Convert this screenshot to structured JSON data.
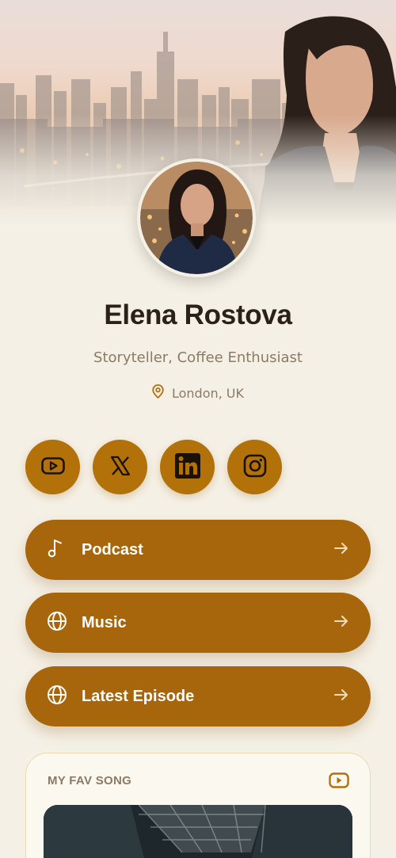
{
  "profile": {
    "name": "Elena Rostova",
    "bio": "Storyteller, Coffee Enthusiast",
    "location": "London, UK"
  },
  "social": [
    {
      "network": "YouTube",
      "icon": "youtube-icon"
    },
    {
      "network": "X",
      "icon": "x-icon"
    },
    {
      "network": "LinkedIn",
      "icon": "linkedin-icon"
    },
    {
      "network": "Instagram",
      "icon": "instagram-icon"
    }
  ],
  "links": [
    {
      "label": "Podcast",
      "icon": "music-note-icon"
    },
    {
      "label": "Music",
      "icon": "globe-icon"
    },
    {
      "label": "Latest Episode",
      "icon": "globe-icon"
    }
  ],
  "fav_song": {
    "title": "MY FAV SONG",
    "icon": "youtube-icon"
  },
  "colors": {
    "background": "#f5f0e5",
    "accent": "#a8660c",
    "social_accent": "#b27109",
    "text_dark": "#2a2218",
    "text_muted": "#8b7a65"
  }
}
